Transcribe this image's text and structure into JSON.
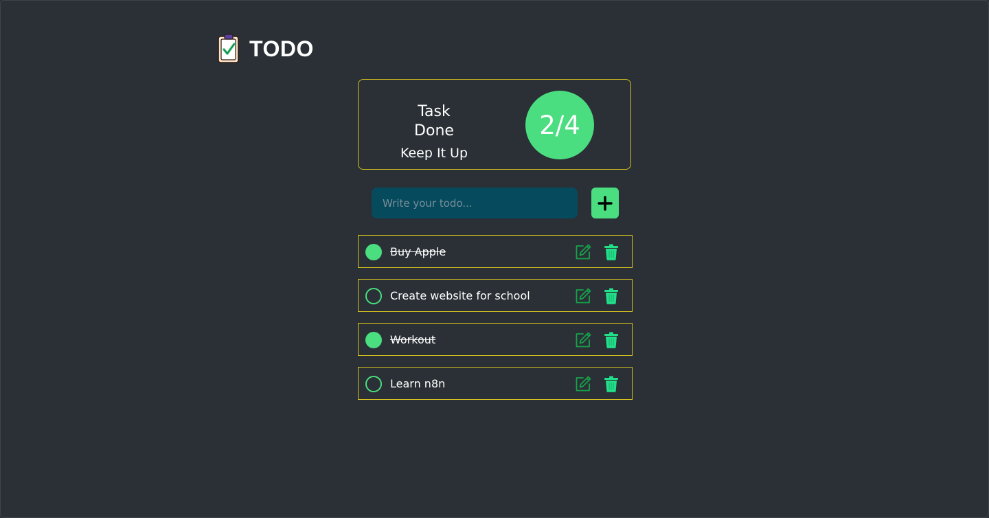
{
  "app": {
    "title": "TODO",
    "logo_icon": "clipboard-check-icon"
  },
  "summary": {
    "title": "Task Done",
    "subtitle": "Keep It Up",
    "count": "2/4"
  },
  "input": {
    "placeholder": "Write your todo...",
    "value": ""
  },
  "add_button": {
    "icon": "plus-icon"
  },
  "todos": [
    {
      "label": "Buy Apple",
      "done": true
    },
    {
      "label": "Create website for school",
      "done": false
    },
    {
      "label": "Workout",
      "done": true
    },
    {
      "label": "Learn n8n",
      "done": false
    }
  ],
  "colors": {
    "background": "#2a3035",
    "accent": "#4ade80",
    "border": "#d5c21f",
    "input_bg": "#064a5e",
    "edit_icon": "#16a34a",
    "delete_icon": "#22e08a"
  }
}
